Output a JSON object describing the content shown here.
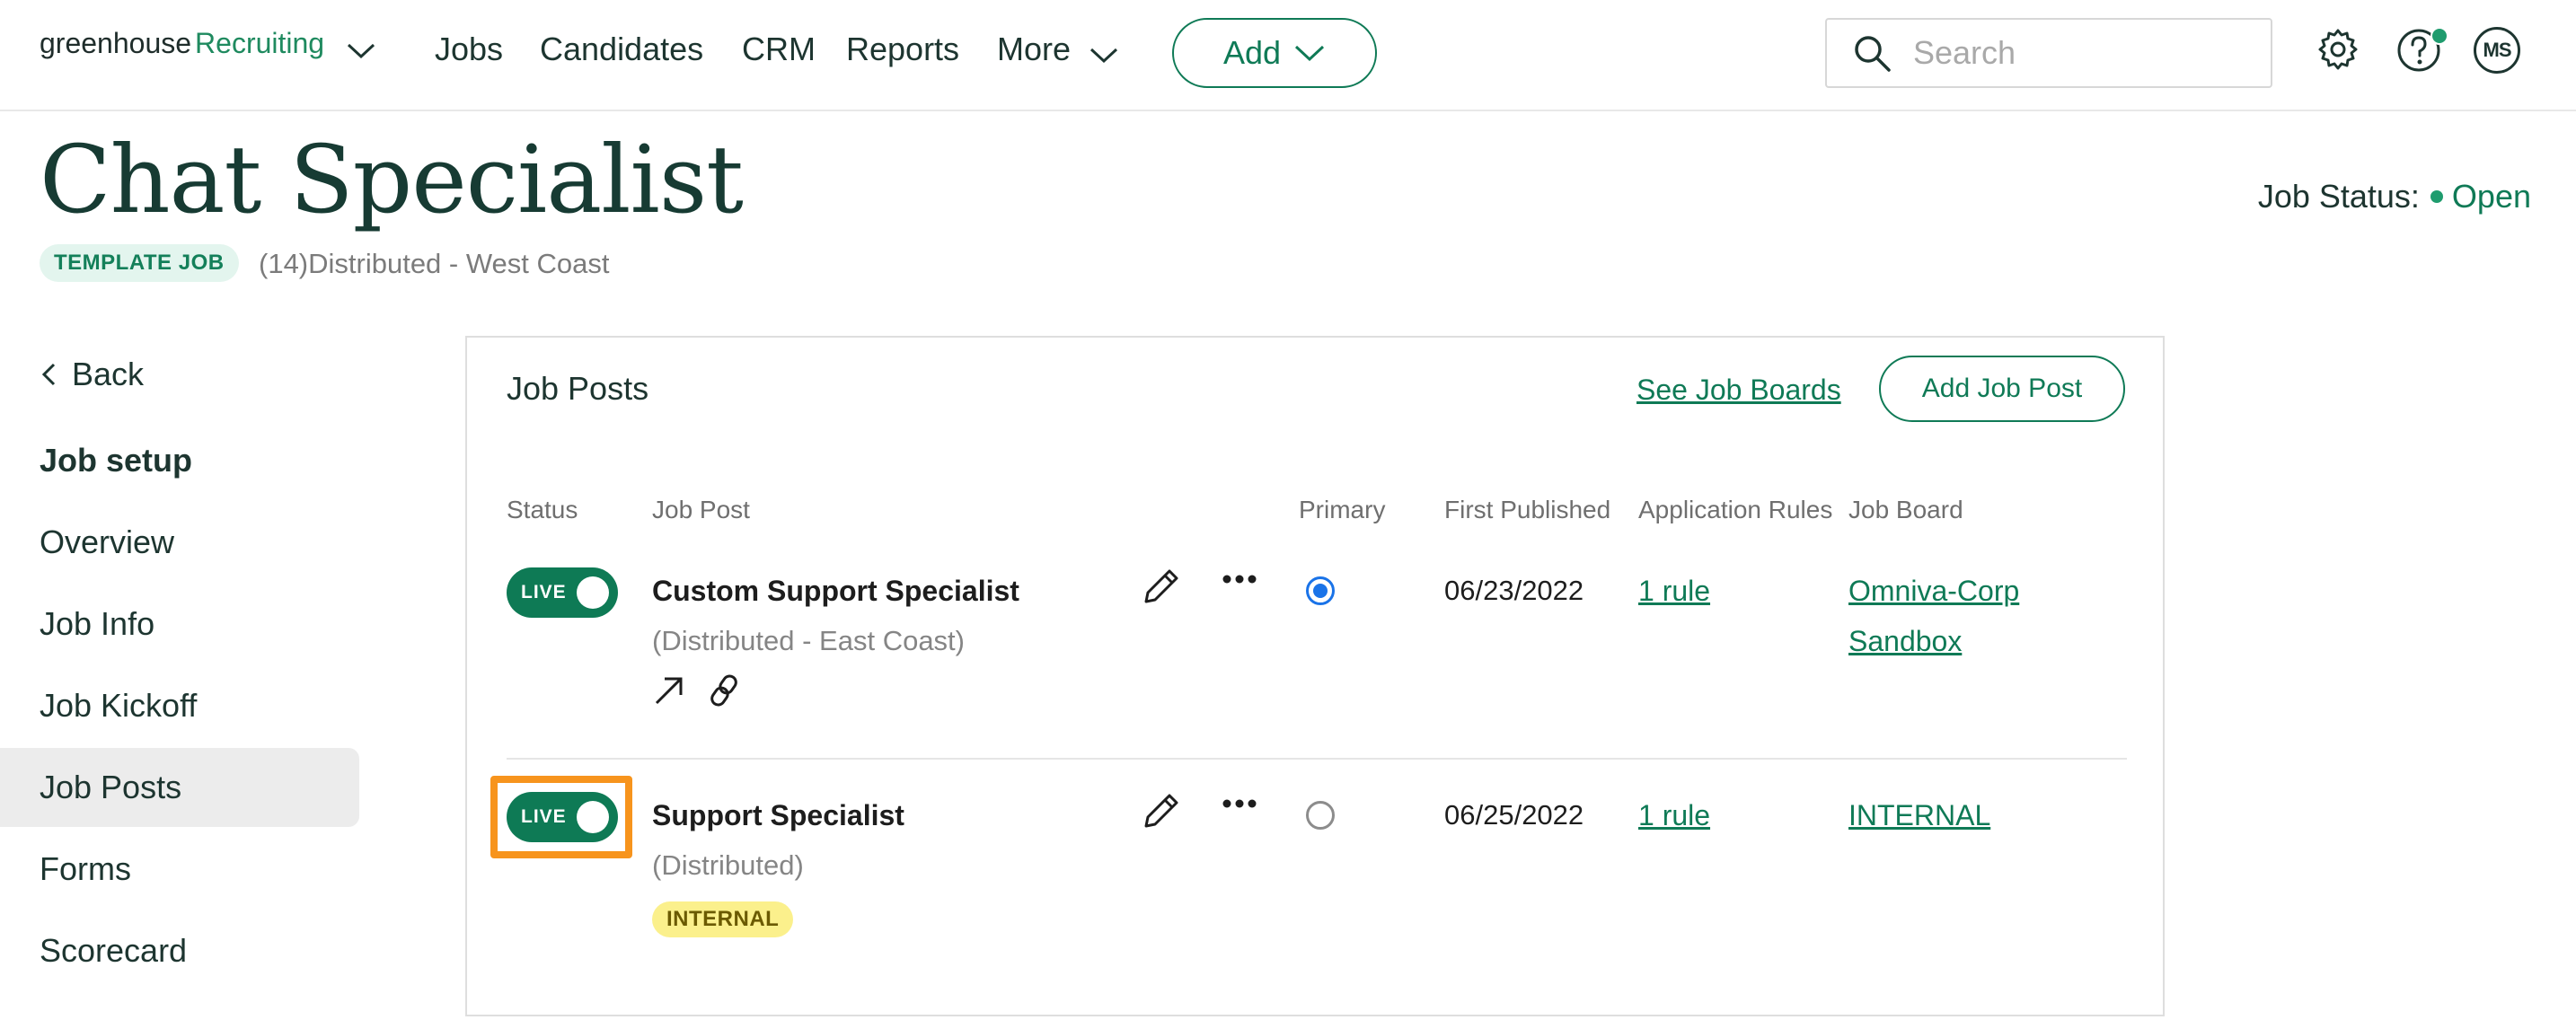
{
  "nav": {
    "logo_main": "greenhouse",
    "logo_product": "Recruiting",
    "items": [
      "Jobs",
      "Candidates",
      "CRM",
      "Reports",
      "More"
    ],
    "add_label": "Add",
    "search_placeholder": "Search",
    "avatar_initials": "MS"
  },
  "header": {
    "title": "Chat Specialist",
    "badge": "TEMPLATE JOB",
    "subtitle": "(14)Distributed - West Coast",
    "status_label": "Job Status:",
    "status_value": "Open"
  },
  "sidebar": {
    "back_label": "Back",
    "heading": "Job setup",
    "items": [
      {
        "label": "Overview",
        "active": false
      },
      {
        "label": "Job Info",
        "active": false
      },
      {
        "label": "Job Kickoff",
        "active": false
      },
      {
        "label": "Job Posts",
        "active": true
      },
      {
        "label": "Forms",
        "active": false
      },
      {
        "label": "Scorecard",
        "active": false
      }
    ]
  },
  "job_posts": {
    "title": "Job Posts",
    "see_boards_label": "See Job Boards",
    "add_post_label": "Add Job Post",
    "columns": [
      "Status",
      "Job Post",
      "Primary",
      "First Published",
      "Application Rules",
      "Job Board"
    ],
    "rows": [
      {
        "status": "LIVE",
        "title": "Custom Support Specialist",
        "location": "(Distributed - East Coast)",
        "primary": true,
        "first_published": "06/23/2022",
        "rules": "1 rule",
        "board_line1": "Omniva-Corp",
        "board_line2": "Sandbox"
      },
      {
        "status": "LIVE",
        "title": "Support Specialist",
        "location": "(Distributed)",
        "badge": "INTERNAL",
        "primary": false,
        "first_published": "06/25/2022",
        "rules": "1 rule",
        "board_line1": "INTERNAL"
      }
    ]
  },
  "colors": {
    "brand_green": "#0f7a56",
    "highlight_orange": "#f7941d",
    "radio_blue": "#1a73e8",
    "internal_yellow": "#fbf08c"
  }
}
